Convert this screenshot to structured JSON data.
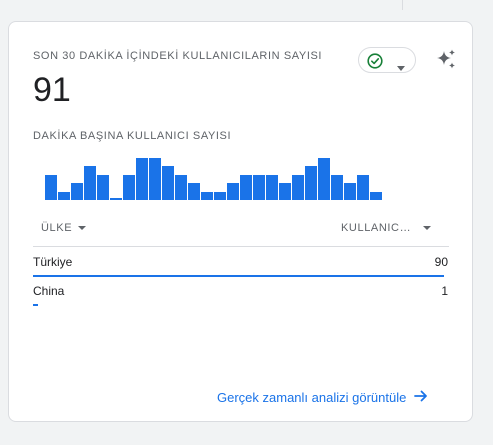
{
  "card": {
    "title": "SON 30 DAKİKA İÇİNDEKİ KULLANICILARIN SAYISI",
    "total_users": "91",
    "subtitle": "DAKİKA BAŞINA KULLANICI SAYISI",
    "status_icon": "check-circle-icon",
    "insights_icon": "sparkle-icon"
  },
  "colors": {
    "accent": "#1a73e8",
    "status_green": "#188038"
  },
  "chart_data": {
    "type": "bar",
    "series": [
      {
        "values": [
          3,
          1,
          2,
          4,
          3,
          0,
          3,
          5,
          5,
          4,
          3,
          2,
          1,
          1,
          2,
          3,
          3,
          3,
          2,
          3,
          4,
          5,
          3,
          2,
          3,
          1
        ]
      }
    ]
  },
  "table": {
    "columns": {
      "country": "ÜLKE",
      "users": "KULLANIC…"
    },
    "rows": [
      {
        "country": "Türkiye",
        "users": "90",
        "share": 0.989
      },
      {
        "country": "China",
        "users": "1",
        "share": 0.011
      }
    ]
  },
  "footer": {
    "link_label": "Gerçek zamanlı analizi görüntüle"
  }
}
